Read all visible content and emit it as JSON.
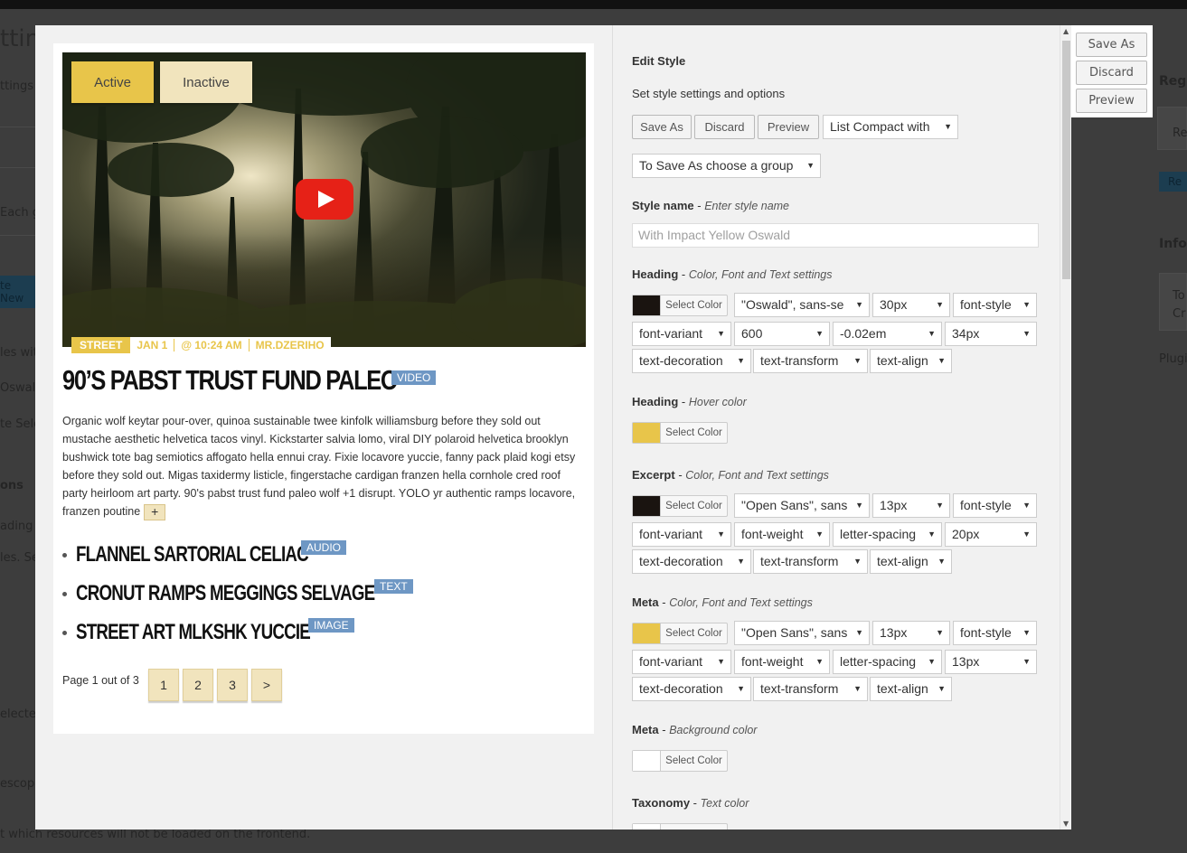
{
  "background": {
    "texts": [
      "ttin",
      "ttings p",
      "Each gr",
      "te New",
      "les wit",
      "Oswal",
      "te Selec",
      "ons",
      "ading",
      "les. Sel",
      "elected",
      "escop",
      "t which resources will not be loaded on the frontend.",
      "Regi",
      "Re",
      "Re",
      "Info",
      "To",
      "Cr",
      "Plugi"
    ]
  },
  "preview": {
    "tabs": {
      "active": "Active",
      "inactive": "Inactive"
    },
    "meta": {
      "category": "STREET",
      "date": "JAN 1",
      "time": "@ 10:24 AM",
      "author": "MR.DZERIHO"
    },
    "title": "90’S PABST TRUST FUND PALEO",
    "title_badge": "VIDEO",
    "excerpt": "Organic wolf keytar pour-over, quinoa sustainable twee kinfolk williamsburg before they sold out mustache aesthetic helvetica tacos vinyl. Kickstarter salvia lomo, viral DIY polaroid helvetica brooklyn bushwick tote bag semiotics affogato hella ennui cray. Fixie locavore yuccie, fanny pack plaid kogi etsy before they sold out. Migas taxidermy listicle, fingerstache cardigan franzen hella cornhole cred roof party heirloom art party. 90's pabst trust fund paleo wolf +1 disrupt. YOLO yr authentic ramps locavore, franzen poutine",
    "more_label": "+",
    "list": [
      {
        "title": "FLANNEL SARTORIAL CELIAC",
        "badge": "AUDIO"
      },
      {
        "title": "CRONUT RAMPS MEGGINGS SELVAGE",
        "badge": "TEXT"
      },
      {
        "title": "STREET ART MLKSHK YUCCIE",
        "badge": "IMAGE"
      }
    ],
    "pager": {
      "text": "Page 1 out of 3",
      "pages": [
        "1",
        "2",
        "3",
        ">"
      ]
    }
  },
  "panel": {
    "title": "Edit Style",
    "subtitle": "Set style settings and options",
    "buttons": {
      "save_as": "Save As",
      "discard": "Discard",
      "preview": "Preview"
    },
    "style_select": "List Compact with",
    "group_select": "To Save As choose a group",
    "style_name": {
      "label": "Style name",
      "hint": "Enter style name",
      "placeholder": "With Impact Yellow Oswald"
    },
    "select_color_label": "Select Color",
    "heading": {
      "label": "Heading",
      "hint": "Color, Font and Text settings",
      "color": "#1a1410",
      "font": "\"Oswald\", sans-se",
      "size": "30px",
      "style": "font-style",
      "variant": "font-variant",
      "weight": "600",
      "spacing": "-0.02em",
      "line": "34px",
      "decoration": "text-decoration",
      "transform": "text-transform",
      "align": "text-align"
    },
    "heading_hover": {
      "label": "Heading",
      "hint": "Hover color",
      "color": "#e8c54a"
    },
    "excerpt": {
      "label": "Excerpt",
      "hint": "Color, Font and Text settings",
      "color": "#1a1410",
      "font": "\"Open Sans\", sans",
      "size": "13px",
      "style": "font-style",
      "variant": "font-variant",
      "weight": "font-weight",
      "spacing": "letter-spacing",
      "line": "20px",
      "decoration": "text-decoration",
      "transform": "text-transform",
      "align": "text-align"
    },
    "meta": {
      "label": "Meta",
      "hint": "Color, Font and Text settings",
      "color": "#e8c54a",
      "font": "\"Open Sans\", sans",
      "size": "13px",
      "style": "font-style",
      "variant": "font-variant",
      "weight": "font-weight",
      "spacing": "letter-spacing",
      "line": "13px",
      "decoration": "text-decoration",
      "transform": "text-transform",
      "align": "text-align"
    },
    "meta_bg": {
      "label": "Meta",
      "hint": "Background color",
      "color": "#ffffff"
    },
    "taxonomy": {
      "label": "Taxonomy",
      "hint": "Text color"
    }
  },
  "float_buttons": {
    "save_as": "Save As",
    "discard": "Discard",
    "preview": "Preview"
  },
  "colors": {
    "accent_yellow": "#e8c54a",
    "accent_cream": "#f1e4bd",
    "badge_blue": "#6e97c4"
  }
}
